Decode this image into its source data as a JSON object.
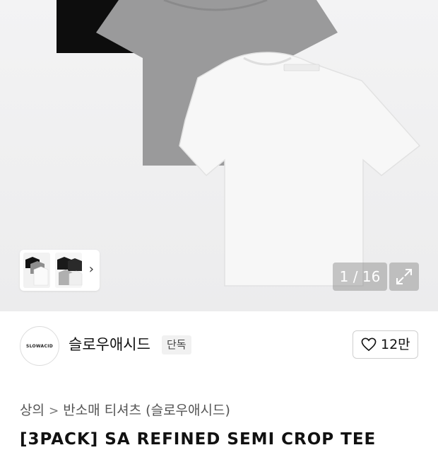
{
  "gallery": {
    "image_alt": "T-shirt set: black, gray, white",
    "counter": "1 / 16",
    "thumb_next": "›",
    "expand_icon": "expand-icon"
  },
  "brand": {
    "logo_text": "SLOWACID",
    "name": "슬로우애시드",
    "badge": "단독",
    "like_count": "12만",
    "like_icon": "heart-outline-icon"
  },
  "breadcrumb": {
    "items": [
      "상의",
      "반소매 티셔츠 (슬로우애시드)"
    ],
    "separator": ">"
  },
  "product": {
    "title_partial": "[3PACK] SA REFINED SEMI CROP TEE"
  },
  "colors": {
    "hero_bg": "#efeff0",
    "shirt_black": "#0d0d0d",
    "shirt_gray": "#9a9a9b",
    "shirt_white": "#f6f6f6"
  }
}
